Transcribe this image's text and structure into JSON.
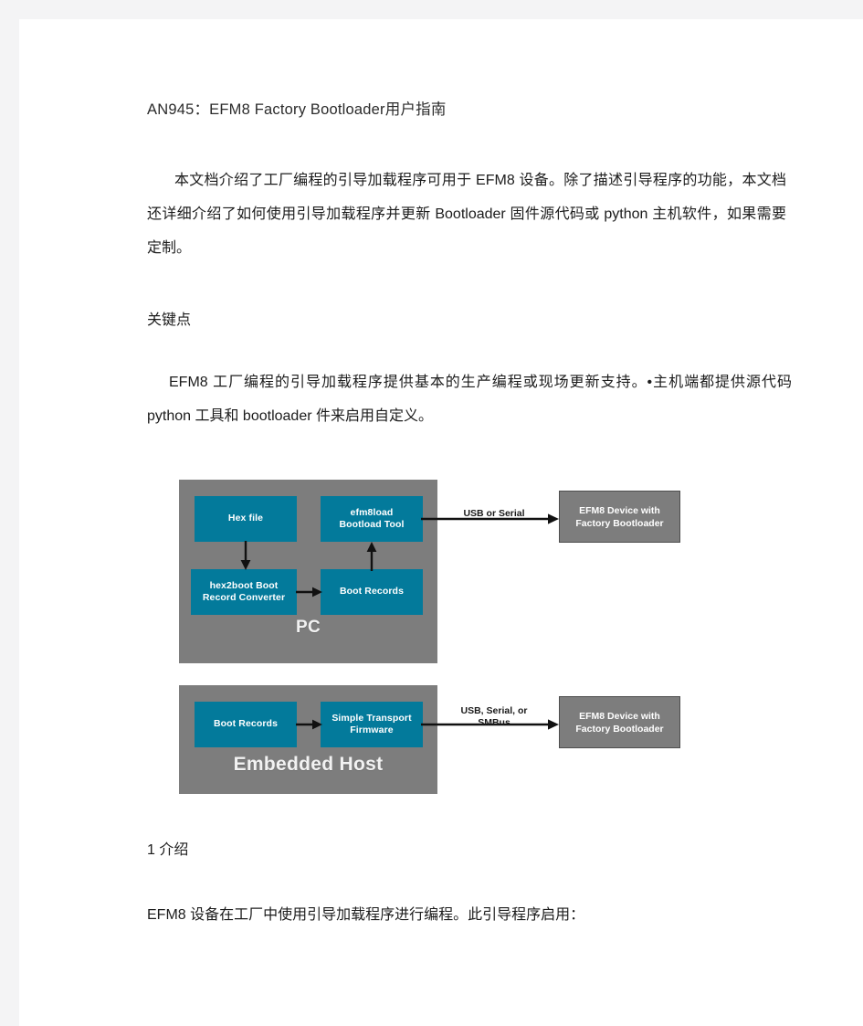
{
  "document": {
    "title": "AN945：EFM8 Factory Bootloader用户指南",
    "paragraphs": {
      "intro": "本文档介绍了工厂编程的引导加载程序可用于 EFM8 设备。除了描述引导程序的功能，本文档还详细介绍了如何使用引导加载程序并更新 Bootloader 固件源代码或 python 主机软件，如果需要定制。",
      "key_points_body": "EFM8 工厂编程的引导加载程序提供基本的生产编程或现场更新支持。•主机端都提供源代码 python 工具和 bootloader 件来启用自定义。",
      "section_1_body": "EFM8 设备在工厂中使用引导加载程序进行编程。此引导程序启用："
    },
    "headings": {
      "key_points": "关键点",
      "section_1": "1 介绍"
    }
  },
  "colors": {
    "page_background": "#ffffff",
    "outer_background": "#f4f4f5",
    "teal_box": "#037a9b",
    "host_panel_gray": "#7d7d7d",
    "device_box_gray": "#7d7d7d",
    "device_box_border": "#4e4e4e",
    "text_primary": "#1c1c1c",
    "box_text": "#ffffff"
  },
  "diagrams": [
    {
      "name": "pc-host-diagram",
      "panel_label": "PC",
      "boxes": [
        {
          "id": "hex-file",
          "label": "Hex file"
        },
        {
          "id": "efm8load-tool",
          "label": "efm8load\nBootload Tool"
        },
        {
          "id": "hex2boot-converter",
          "label": "hex2boot Boot\nRecord Converter"
        },
        {
          "id": "boot-records",
          "label": "Boot Records"
        }
      ],
      "link_label": "USB or Serial",
      "device": "EFM8 Device with\nFactory Bootloader",
      "arrows": [
        {
          "from": "hex-file",
          "to": "hex2boot-converter",
          "direction": "down"
        },
        {
          "from": "hex2boot-converter",
          "to": "boot-records",
          "direction": "right"
        },
        {
          "from": "boot-records",
          "to": "efm8load-tool",
          "direction": "up"
        },
        {
          "from": "efm8load-tool",
          "to": "device",
          "direction": "right"
        }
      ]
    },
    {
      "name": "embedded-host-diagram",
      "panel_label": "Embedded Host",
      "boxes": [
        {
          "id": "boot-records",
          "label": "Boot Records"
        },
        {
          "id": "simple-transport-firmware",
          "label": "Simple Transport\nFirmware"
        }
      ],
      "link_label": "USB, Serial, or\nSMBus",
      "device": "EFM8 Device with\nFactory Bootloader",
      "arrows": [
        {
          "from": "boot-records",
          "to": "simple-transport-firmware",
          "direction": "right"
        },
        {
          "from": "simple-transport-firmware",
          "to": "device",
          "direction": "right"
        }
      ]
    }
  ]
}
